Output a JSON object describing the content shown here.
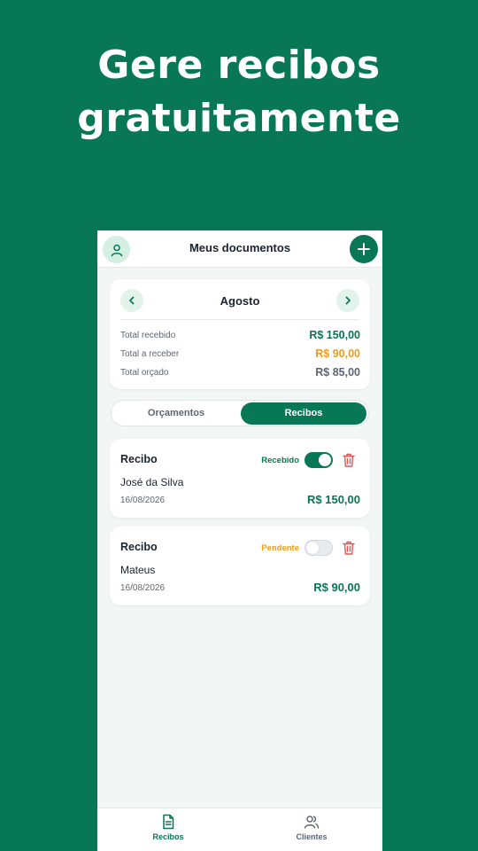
{
  "hero": {
    "line1": "Gere recibos",
    "line2": "gratuitamente"
  },
  "header": {
    "title": "Meus documentos",
    "avatar_icon": "user-icon",
    "add_icon": "plus-icon"
  },
  "summary": {
    "month": "Agosto",
    "rows": [
      {
        "label": "Total recebido",
        "value": "R$ 150,00",
        "color": "#077756"
      },
      {
        "label": "Total a receber",
        "value": "R$ 90,00",
        "color": "#f29b1d"
      },
      {
        "label": "Total orçado",
        "value": "R$ 85,00",
        "color": "#5d6672"
      }
    ]
  },
  "tabs": [
    {
      "label": "Orçamentos",
      "active": false
    },
    {
      "label": "Recibos",
      "active": true
    }
  ],
  "receipts": [
    {
      "title": "Recibo",
      "status": "Recebido",
      "status_color": "#077756",
      "toggle_on": true,
      "name": "José da Silva",
      "date": "16/08/2026",
      "amount": "R$ 150,00"
    },
    {
      "title": "Recibo",
      "status": "Pendente",
      "status_color": "#f29b1d",
      "toggle_on": false,
      "name": "Mateus",
      "date": "16/08/2026",
      "amount": "R$ 90,00"
    }
  ],
  "bottom_nav": [
    {
      "label": "Recibos",
      "icon": "document-icon",
      "active": true
    },
    {
      "label": "Clientes",
      "icon": "users-icon",
      "active": false
    }
  ],
  "colors": {
    "brand": "#077756",
    "pending": "#f29b1d",
    "danger": "#e05555"
  }
}
